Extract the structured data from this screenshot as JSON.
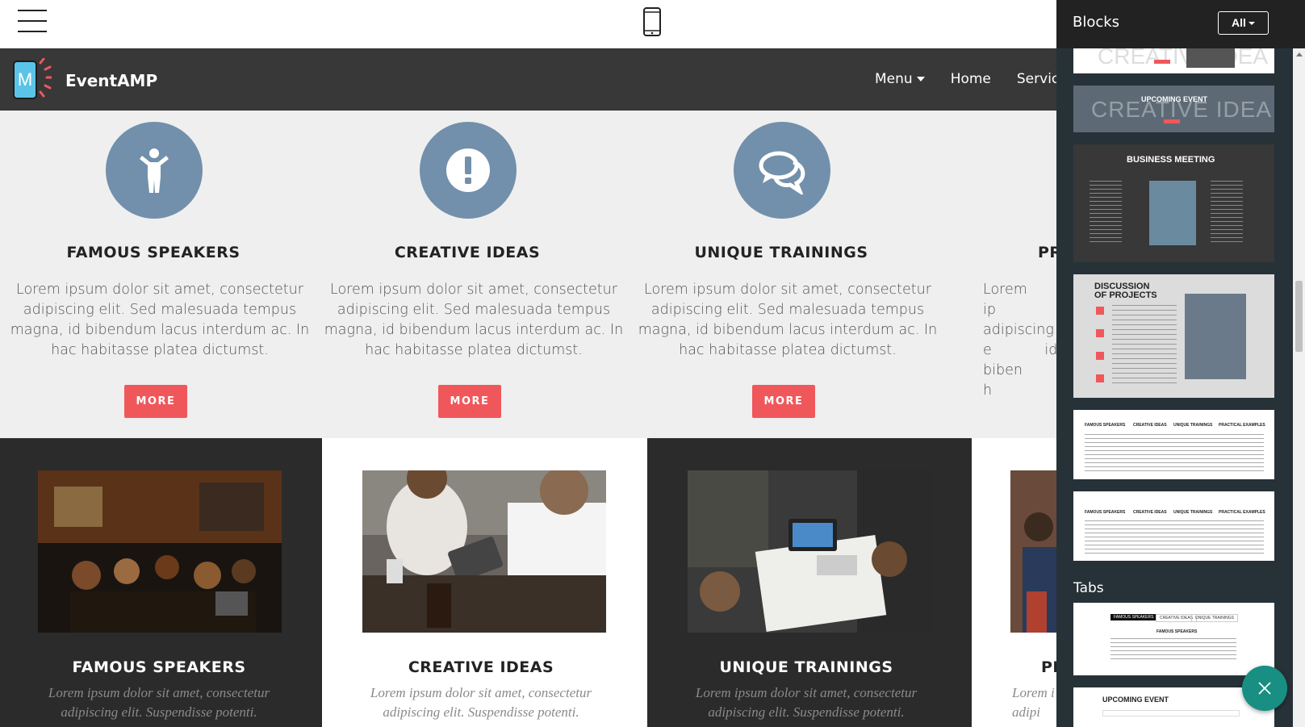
{
  "toolbar": {
    "menu_icon": "hamburger-icon",
    "preview_icon": "mobile-phone-icon"
  },
  "site": {
    "brand": "EventAMP",
    "nav": {
      "menu": "Menu",
      "home": "Home",
      "services": "Services"
    }
  },
  "features": [
    {
      "icon": "child-icon",
      "title": "FAMOUS SPEAKERS",
      "text": "Lorem ipsum dolor sit amet, consectetur adipiscing elit. Sed malesuada tempus magna, id bibendum lacus interdum ac. In hac habitasse platea dictumst.",
      "button": "MORE"
    },
    {
      "icon": "exclamation-icon",
      "title": "CREATIVE IDEAS",
      "text": "Lorem ipsum dolor sit amet, consectetur adipiscing elit. Sed malesuada tempus magna, id bibendum lacus interdum ac. In hac habitasse platea dictumst.",
      "button": "MORE"
    },
    {
      "icon": "chat-bubbles-icon",
      "title": "UNIQUE TRAININGS",
      "text": "Lorem ipsum dolor sit amet, consectetur adipiscing elit. Sed malesuada tempus magna, id bibendum lacus interdum ac. In hac habitasse platea dictumst.",
      "button": "MORE"
    },
    {
      "icon": "",
      "title": "PR",
      "text": "Lorem ip adipiscing e id biben h",
      "button": ""
    }
  ],
  "cards": [
    {
      "title": "FAMOUS SPEAKERS",
      "text": "Lorem ipsum dolor sit amet, consectetur adipiscing elit. Suspendisse potenti."
    },
    {
      "title": "CREATIVE IDEAS",
      "text": "Lorem ipsum dolor sit amet, consectetur adipiscing elit. Suspendisse potenti."
    },
    {
      "title": "UNIQUE TRAININGS",
      "text": "Lorem ipsum dolor sit amet, consectetur adipiscing elit. Suspendisse potenti."
    },
    {
      "title": "PR",
      "text": "Lorem i adipi"
    }
  ],
  "panel": {
    "title": "Blocks",
    "filter": "All",
    "tabs_heading": "Tabs",
    "thumbnails": {
      "upcoming_event": "UPCOMING EVENT",
      "creative_idea_bg": "CREATIVE IDEA",
      "business_meeting": "BUSINESS MEETING",
      "discussion": "DISCUSSION OF PROJECTS",
      "feature_cols": [
        "FAMOUS SPEAKERS",
        "CREATIVE IDEAS",
        "UNIQUE TRAININGS",
        "PRACTICAL EXAMPLES"
      ],
      "tabs": [
        "FAMOUS SPEAKERS",
        "CREATIVE IDEAS",
        "UNIQUE TRAININGS"
      ],
      "tab_content_title": "FAMOUS SPEAKERS",
      "upcoming_event_2": "UPCOMING EVENT"
    }
  },
  "fab_icon": "close-icon",
  "colors": {
    "accent": "#f0575b",
    "icon_circle": "#7290ab",
    "navbar": "#383838",
    "panel": "#263238",
    "fab": "#188f82"
  }
}
